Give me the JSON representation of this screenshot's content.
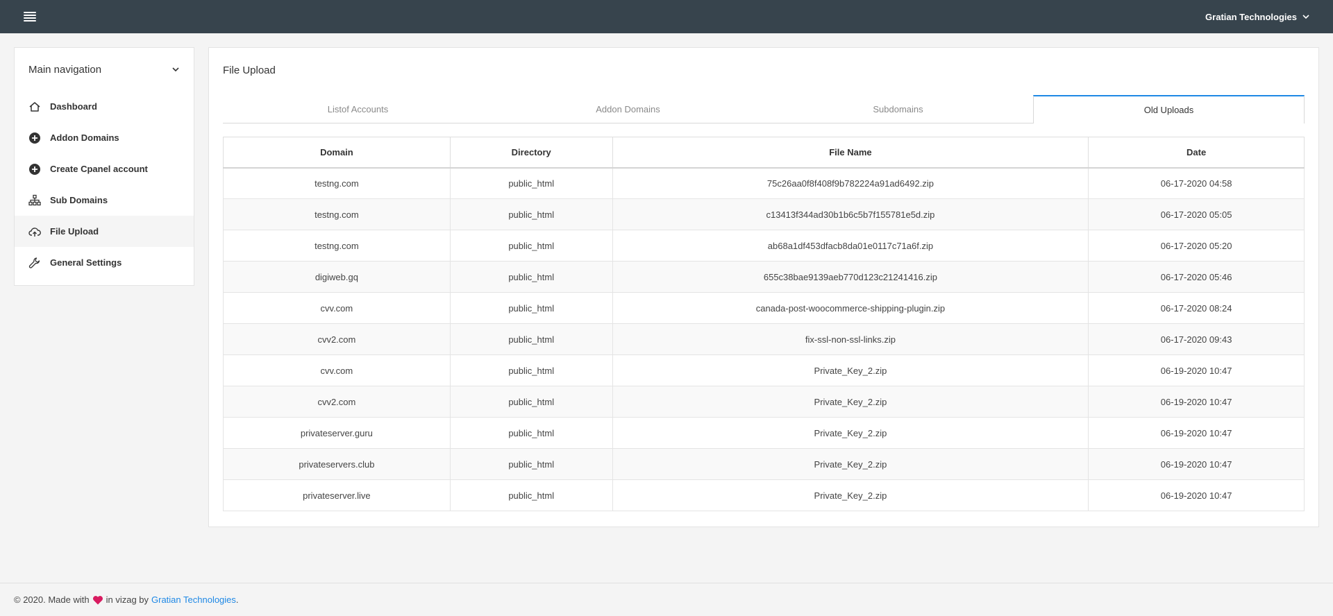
{
  "header": {
    "company": "Gratian Technologies"
  },
  "sidebar": {
    "title": "Main navigation",
    "items": [
      {
        "label": "Dashboard",
        "icon": "home-icon"
      },
      {
        "label": "Addon Domains",
        "icon": "plus-circle-icon"
      },
      {
        "label": "Create Cpanel account",
        "icon": "plus-circle-icon"
      },
      {
        "label": "Sub Domains",
        "icon": "sitemap-icon"
      },
      {
        "label": "File Upload",
        "icon": "cloud-upload-icon",
        "active": true
      },
      {
        "label": "General Settings",
        "icon": "wrench-icon"
      }
    ]
  },
  "main": {
    "title": "File Upload",
    "tabs": [
      {
        "label": "Listof Accounts"
      },
      {
        "label": "Addon Domains"
      },
      {
        "label": "Subdomains"
      },
      {
        "label": "Old Uploads",
        "active": true
      }
    ],
    "table": {
      "columns": [
        "Domain",
        "Directory",
        "File Name",
        "Date"
      ],
      "rows": [
        [
          "testng.com",
          "public_html",
          "75c26aa0f8f408f9b782224a91ad6492.zip",
          "06-17-2020 04:58"
        ],
        [
          "testng.com",
          "public_html",
          "c13413f344ad30b1b6c5b7f155781e5d.zip",
          "06-17-2020 05:05"
        ],
        [
          "testng.com",
          "public_html",
          "ab68a1df453dfacb8da01e0117c71a6f.zip",
          "06-17-2020 05:20"
        ],
        [
          "digiweb.gq",
          "public_html",
          "655c38bae9139aeb770d123c21241416.zip",
          "06-17-2020 05:46"
        ],
        [
          "cvv.com",
          "public_html",
          "canada-post-woocommerce-shipping-plugin.zip",
          "06-17-2020 08:24"
        ],
        [
          "cvv2.com",
          "public_html",
          "fix-ssl-non-ssl-links.zip",
          "06-17-2020 09:43"
        ],
        [
          "cvv.com",
          "public_html",
          "Private_Key_2.zip",
          "06-19-2020 10:47"
        ],
        [
          "cvv2.com",
          "public_html",
          "Private_Key_2.zip",
          "06-19-2020 10:47"
        ],
        [
          "privateserver.guru",
          "public_html",
          "Private_Key_2.zip",
          "06-19-2020 10:47"
        ],
        [
          "privateservers.club",
          "public_html",
          "Private_Key_2.zip",
          "06-19-2020 10:47"
        ],
        [
          "privateserver.live",
          "public_html",
          "Private_Key_2.zip",
          "06-19-2020 10:47"
        ]
      ]
    }
  },
  "footer": {
    "prefix": "© 2020. Made with",
    "middle": "in vizag by",
    "link": "Gratian Technologies",
    "suffix": ".",
    "heart_color": "#d81b60"
  },
  "colors": {
    "topbar": "#37444d",
    "accent": "#1e88e5"
  }
}
